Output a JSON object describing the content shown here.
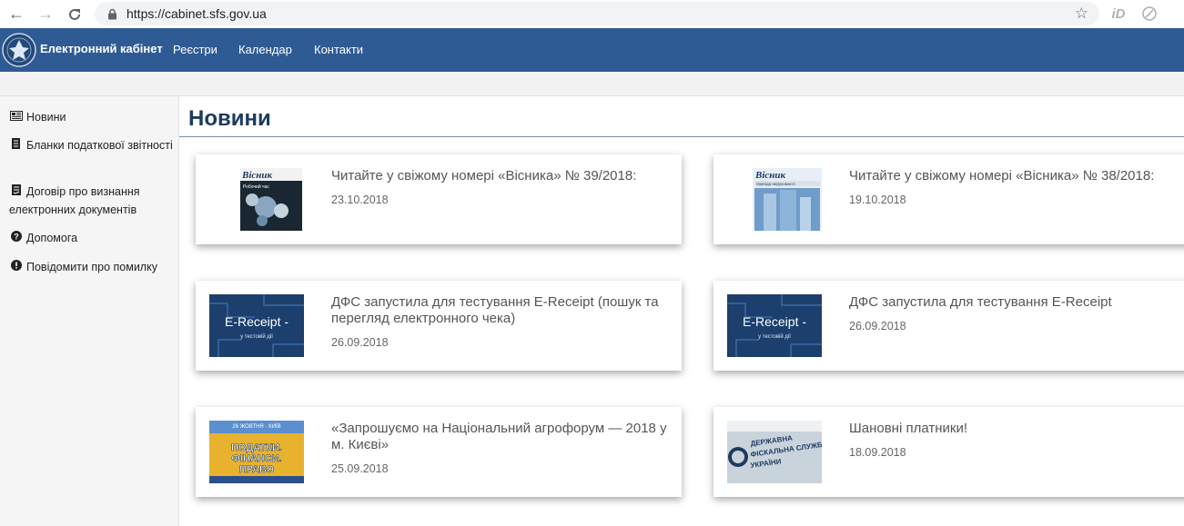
{
  "browser": {
    "url": "https://cabinet.sfs.gov.ua"
  },
  "header": {
    "brand": "Електронний кабінет",
    "nav": [
      "Реєстри",
      "Календар",
      "Контакти"
    ]
  },
  "sidebar": {
    "items": [
      {
        "label": "Новини",
        "icon": "newspaper-icon"
      },
      {
        "label": "Бланки податкової звітності",
        "icon": "document-icon"
      },
      {
        "label": "Договір про визнання електронних документів",
        "icon": "contract-icon"
      },
      {
        "label": "Допомога",
        "icon": "question-circle-icon"
      },
      {
        "label": "Повідомити про помилку",
        "icon": "exclamation-circle-icon"
      }
    ]
  },
  "main": {
    "title": "Новини",
    "news": [
      {
        "title": "Читайте у свіжому номері «Вісника» № 39/2018:",
        "date": "23.10.2018",
        "thumb": "visnyk-39"
      },
      {
        "title": "Читайте у свіжому номері «Вісника» № 38/2018:",
        "date": "19.10.2018",
        "thumb": "visnyk-38"
      },
      {
        "title": "ДФС запустила для тестування Е-Receipt (пошук та перегляд електронного чека)",
        "date": "26.09.2018",
        "thumb": "e-receipt"
      },
      {
        "title": "ДФС запустила для тестування Е-Receipt",
        "date": "26.09.2018",
        "thumb": "e-receipt"
      },
      {
        "title": "«Запрошуємо на Національний агрофорум — 2018 у м. Києві»",
        "date": "25.09.2018",
        "thumb": "agroforum"
      },
      {
        "title": "Шановні платники!",
        "date": "18.09.2018",
        "thumb": "dfs-sign"
      }
    ],
    "thumb_text": {
      "visnyk": "Вісник",
      "visnyk_39_sub": "Робочий час",
      "visnyk_38_sub": "Оренда нерухомості",
      "ereceipt": "E-Receipt -",
      "ereceipt_sub": "у тестовій дії",
      "agro_top": "26 ЖОВТНЯ · КИЇВ",
      "agro_l1": "ПОДАТКИ.",
      "agro_l2": "ФІНАНСИ.",
      "agro_l3": "ПРАВО",
      "dfs_l1": "ДЕРЖАВНА",
      "dfs_l2": "ФІСКАЛЬНА СЛУЖБА",
      "dfs_l3": "УКРАЇНИ"
    }
  },
  "colors": {
    "header_bg": "#2f5b95",
    "title": "#1d3b5e"
  }
}
